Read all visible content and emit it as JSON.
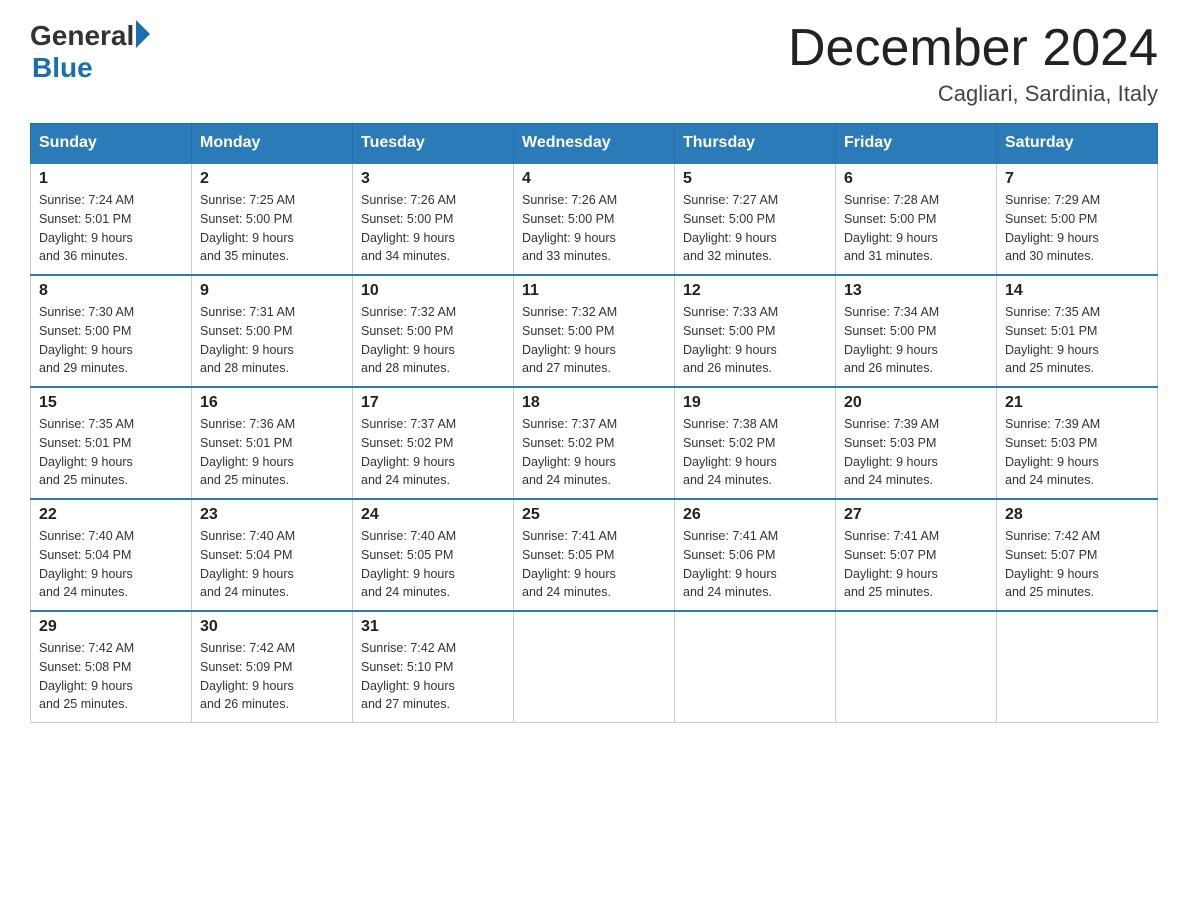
{
  "header": {
    "logo_general": "General",
    "logo_blue": "Blue",
    "month_title": "December 2024",
    "location": "Cagliari, Sardinia, Italy"
  },
  "days_of_week": [
    "Sunday",
    "Monday",
    "Tuesday",
    "Wednesday",
    "Thursday",
    "Friday",
    "Saturday"
  ],
  "weeks": [
    [
      {
        "day": "1",
        "sunrise": "7:24 AM",
        "sunset": "5:01 PM",
        "daylight": "9 hours and 36 minutes."
      },
      {
        "day": "2",
        "sunrise": "7:25 AM",
        "sunset": "5:00 PM",
        "daylight": "9 hours and 35 minutes."
      },
      {
        "day": "3",
        "sunrise": "7:26 AM",
        "sunset": "5:00 PM",
        "daylight": "9 hours and 34 minutes."
      },
      {
        "day": "4",
        "sunrise": "7:26 AM",
        "sunset": "5:00 PM",
        "daylight": "9 hours and 33 minutes."
      },
      {
        "day": "5",
        "sunrise": "7:27 AM",
        "sunset": "5:00 PM",
        "daylight": "9 hours and 32 minutes."
      },
      {
        "day": "6",
        "sunrise": "7:28 AM",
        "sunset": "5:00 PM",
        "daylight": "9 hours and 31 minutes."
      },
      {
        "day": "7",
        "sunrise": "7:29 AM",
        "sunset": "5:00 PM",
        "daylight": "9 hours and 30 minutes."
      }
    ],
    [
      {
        "day": "8",
        "sunrise": "7:30 AM",
        "sunset": "5:00 PM",
        "daylight": "9 hours and 29 minutes."
      },
      {
        "day": "9",
        "sunrise": "7:31 AM",
        "sunset": "5:00 PM",
        "daylight": "9 hours and 28 minutes."
      },
      {
        "day": "10",
        "sunrise": "7:32 AM",
        "sunset": "5:00 PM",
        "daylight": "9 hours and 28 minutes."
      },
      {
        "day": "11",
        "sunrise": "7:32 AM",
        "sunset": "5:00 PM",
        "daylight": "9 hours and 27 minutes."
      },
      {
        "day": "12",
        "sunrise": "7:33 AM",
        "sunset": "5:00 PM",
        "daylight": "9 hours and 26 minutes."
      },
      {
        "day": "13",
        "sunrise": "7:34 AM",
        "sunset": "5:00 PM",
        "daylight": "9 hours and 26 minutes."
      },
      {
        "day": "14",
        "sunrise": "7:35 AM",
        "sunset": "5:01 PM",
        "daylight": "9 hours and 25 minutes."
      }
    ],
    [
      {
        "day": "15",
        "sunrise": "7:35 AM",
        "sunset": "5:01 PM",
        "daylight": "9 hours and 25 minutes."
      },
      {
        "day": "16",
        "sunrise": "7:36 AM",
        "sunset": "5:01 PM",
        "daylight": "9 hours and 25 minutes."
      },
      {
        "day": "17",
        "sunrise": "7:37 AM",
        "sunset": "5:02 PM",
        "daylight": "9 hours and 24 minutes."
      },
      {
        "day": "18",
        "sunrise": "7:37 AM",
        "sunset": "5:02 PM",
        "daylight": "9 hours and 24 minutes."
      },
      {
        "day": "19",
        "sunrise": "7:38 AM",
        "sunset": "5:02 PM",
        "daylight": "9 hours and 24 minutes."
      },
      {
        "day": "20",
        "sunrise": "7:39 AM",
        "sunset": "5:03 PM",
        "daylight": "9 hours and 24 minutes."
      },
      {
        "day": "21",
        "sunrise": "7:39 AM",
        "sunset": "5:03 PM",
        "daylight": "9 hours and 24 minutes."
      }
    ],
    [
      {
        "day": "22",
        "sunrise": "7:40 AM",
        "sunset": "5:04 PM",
        "daylight": "9 hours and 24 minutes."
      },
      {
        "day": "23",
        "sunrise": "7:40 AM",
        "sunset": "5:04 PM",
        "daylight": "9 hours and 24 minutes."
      },
      {
        "day": "24",
        "sunrise": "7:40 AM",
        "sunset": "5:05 PM",
        "daylight": "9 hours and 24 minutes."
      },
      {
        "day": "25",
        "sunrise": "7:41 AM",
        "sunset": "5:05 PM",
        "daylight": "9 hours and 24 minutes."
      },
      {
        "day": "26",
        "sunrise": "7:41 AM",
        "sunset": "5:06 PM",
        "daylight": "9 hours and 24 minutes."
      },
      {
        "day": "27",
        "sunrise": "7:41 AM",
        "sunset": "5:07 PM",
        "daylight": "9 hours and 25 minutes."
      },
      {
        "day": "28",
        "sunrise": "7:42 AM",
        "sunset": "5:07 PM",
        "daylight": "9 hours and 25 minutes."
      }
    ],
    [
      {
        "day": "29",
        "sunrise": "7:42 AM",
        "sunset": "5:08 PM",
        "daylight": "9 hours and 25 minutes."
      },
      {
        "day": "30",
        "sunrise": "7:42 AM",
        "sunset": "5:09 PM",
        "daylight": "9 hours and 26 minutes."
      },
      {
        "day": "31",
        "sunrise": "7:42 AM",
        "sunset": "5:10 PM",
        "daylight": "9 hours and 27 minutes."
      },
      null,
      null,
      null,
      null
    ]
  ],
  "labels": {
    "sunrise": "Sunrise:",
    "sunset": "Sunset:",
    "daylight": "Daylight:"
  }
}
